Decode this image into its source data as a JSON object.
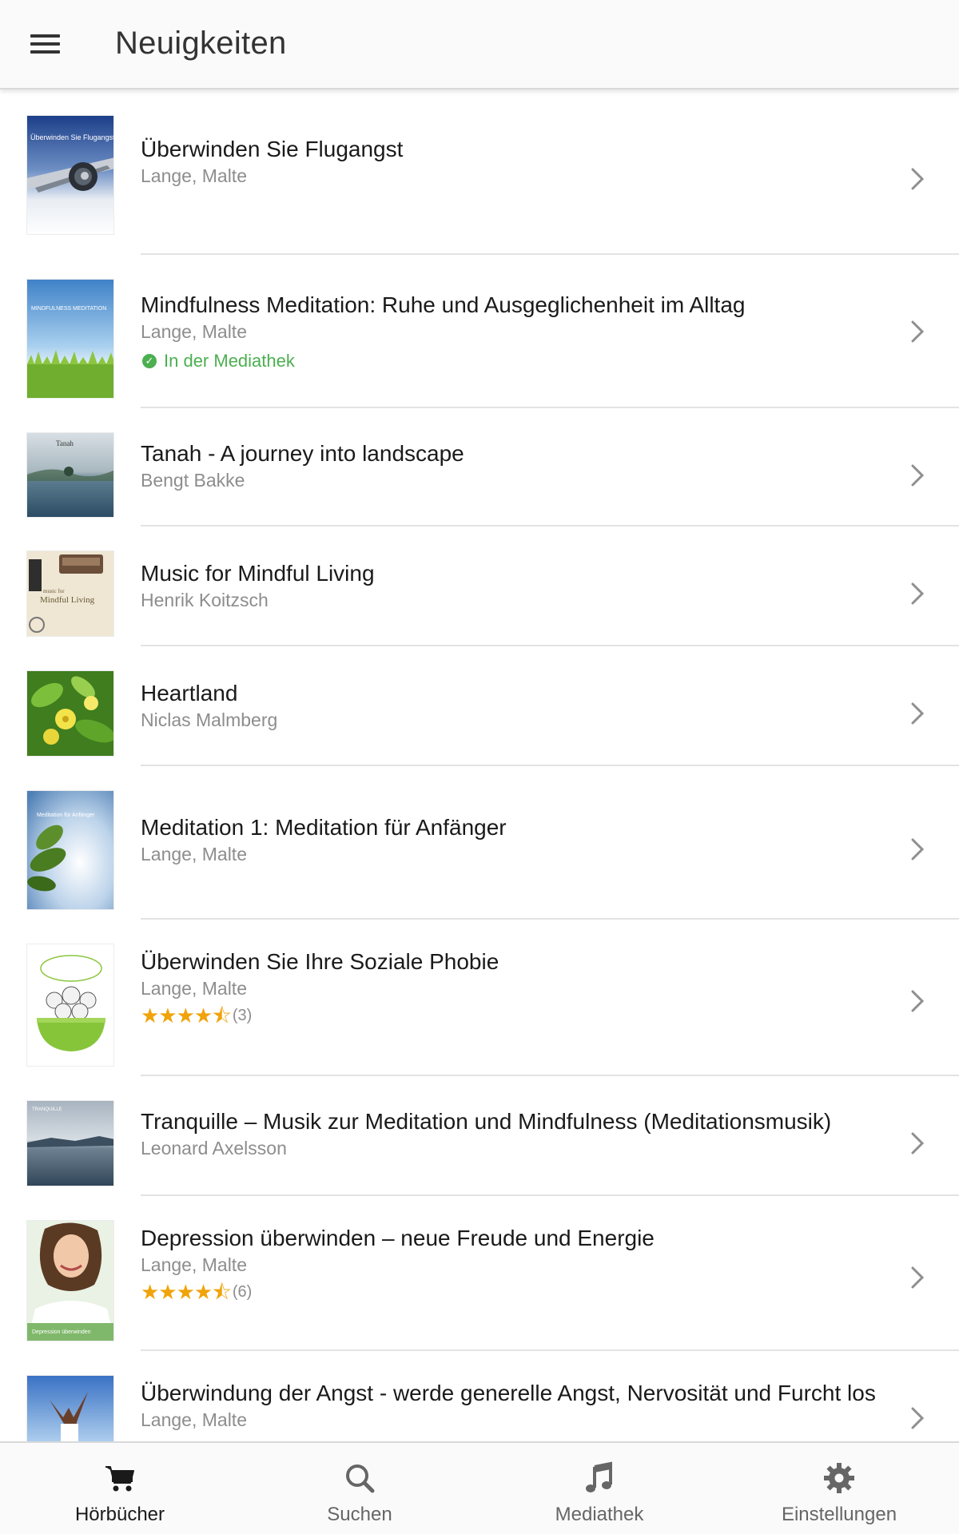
{
  "header": {
    "title": "Neuigkeiten",
    "menu_icon": "hamburger-menu-icon"
  },
  "colors": {
    "accent_green": "#4caf50",
    "star": "#f0a30a",
    "muted_text": "#8d8d8d"
  },
  "items": [
    {
      "title": "Überwinden Sie Flugangst",
      "author": "Lange, Malte",
      "cover_text": "Überwinden Sie Flugangst"
    },
    {
      "title": "Mindfulness Meditation: Ruhe und Ausgeglichenheit im Alltag",
      "author": "Lange, Malte",
      "status": "In der Mediathek",
      "cover_text": "MINDFULNESS MEDITATION"
    },
    {
      "title": "Tanah - A journey into landscape",
      "author": "Bengt Bakke",
      "cover_text": "Tanah"
    },
    {
      "title": "Music for Mindful Living",
      "author": "Henrik Koitzsch",
      "cover_text_1": "music for",
      "cover_text_2": "Mindful Living"
    },
    {
      "title": "Heartland",
      "author": "Niclas Malmberg"
    },
    {
      "title": "Meditation 1: Meditation für Anfänger",
      "author": "Lange, Malte",
      "cover_text": "Meditation für Anfänger"
    },
    {
      "title": "Überwinden Sie Ihre Soziale Phobie",
      "author": "Lange, Malte",
      "rating": 4.5,
      "stars": "★★★★⯪",
      "rating_count": "(3)"
    },
    {
      "title": "Tranquille – Musik zur Meditation und Mindfulness (Meditationsmusik)",
      "author": "Leonard Axelsson",
      "cover_text": "TRANQUILLE"
    },
    {
      "title": "Depression überwinden – neue Freude und Energie",
      "author": "Lange, Malte",
      "rating": 4.5,
      "stars": "★★★★⯪",
      "rating_count": "(6)",
      "cover_text": "Depression überwinden"
    },
    {
      "title": "Überwindung der Angst - werde generelle Angst, Nervosität und Furcht los",
      "author": "Lange, Malte"
    }
  ],
  "tabs": [
    {
      "label": "Hörbücher",
      "icon": "cart-icon",
      "active": true
    },
    {
      "label": "Suchen",
      "icon": "search-icon",
      "active": false
    },
    {
      "label": "Mediathek",
      "icon": "music-note-icon",
      "active": false
    },
    {
      "label": "Einstellungen",
      "icon": "gear-icon",
      "active": false
    }
  ]
}
